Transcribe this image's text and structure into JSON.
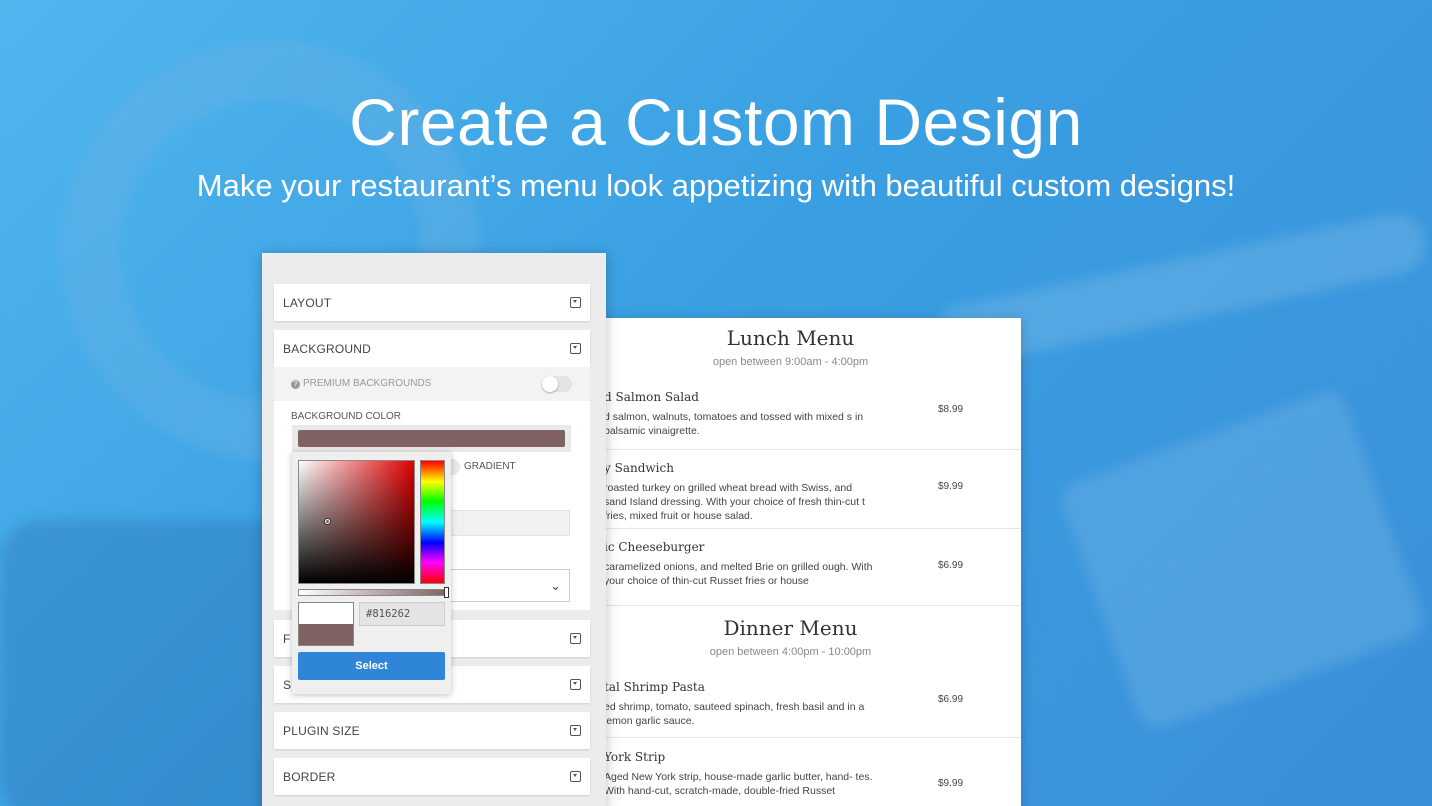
{
  "hero": {
    "title": "Create a Custom Design",
    "subtitle": "Make your restaurant’s menu look appetizing with beautiful custom designs!"
  },
  "panel": {
    "sections": {
      "layout": "LAYOUT",
      "background": "BACKGROUND",
      "font_partial": "F",
      "spacing_partial": "S",
      "plugin_size": "PLUGIN SIZE",
      "border": "BORDER"
    },
    "background": {
      "premium_label": "PREMIUM BACKGROUNDS",
      "premium_enabled": false,
      "color_label": "BACKGROUND COLOR",
      "color_value": "#816262",
      "gradient_label": "GRADIENT"
    },
    "picker": {
      "hex_value": "#816262",
      "select_label": "Select"
    }
  },
  "menu": {
    "lunch": {
      "title": "Lunch Menu",
      "hours": "open between 9:00am - 4:00pm",
      "items": [
        {
          "name": "d Salmon Salad",
          "desc": "d salmon, walnuts, tomatoes and tossed with mixed s in balsamic vinaigrette.",
          "price": "$8.99"
        },
        {
          "name": "y Sandwich",
          "desc": "roasted turkey on grilled wheat bread with Swiss, and sand Island dressing. With your choice of fresh thin-cut t fries, mixed fruit or house salad.",
          "price": "$9.99"
        },
        {
          "name": "ic Cheeseburger",
          "desc": "caramelized onions, and melted Brie on grilled ough. With your choice of thin-cut Russet fries or house",
          "price": "$6.99"
        }
      ]
    },
    "dinner": {
      "title": "Dinner Menu",
      "hours": "open between 4:00pm - 10:00pm",
      "items": [
        {
          "name": "tal Shrimp Pasta",
          "desc": "ed shrimp, tomato, sauteed spinach, fresh basil and in a lemon garlic sauce.",
          "price": "$6.99"
        },
        {
          "name": "York Strip",
          "desc": "Aged New York strip, house-made garlic butter, hand- tes. With hand-cut, scratch-made, double-fried Russet",
          "price": "$9.99"
        }
      ]
    }
  },
  "colors": {
    "accent": "#2f86d9",
    "selected_swatch": "#816262"
  }
}
